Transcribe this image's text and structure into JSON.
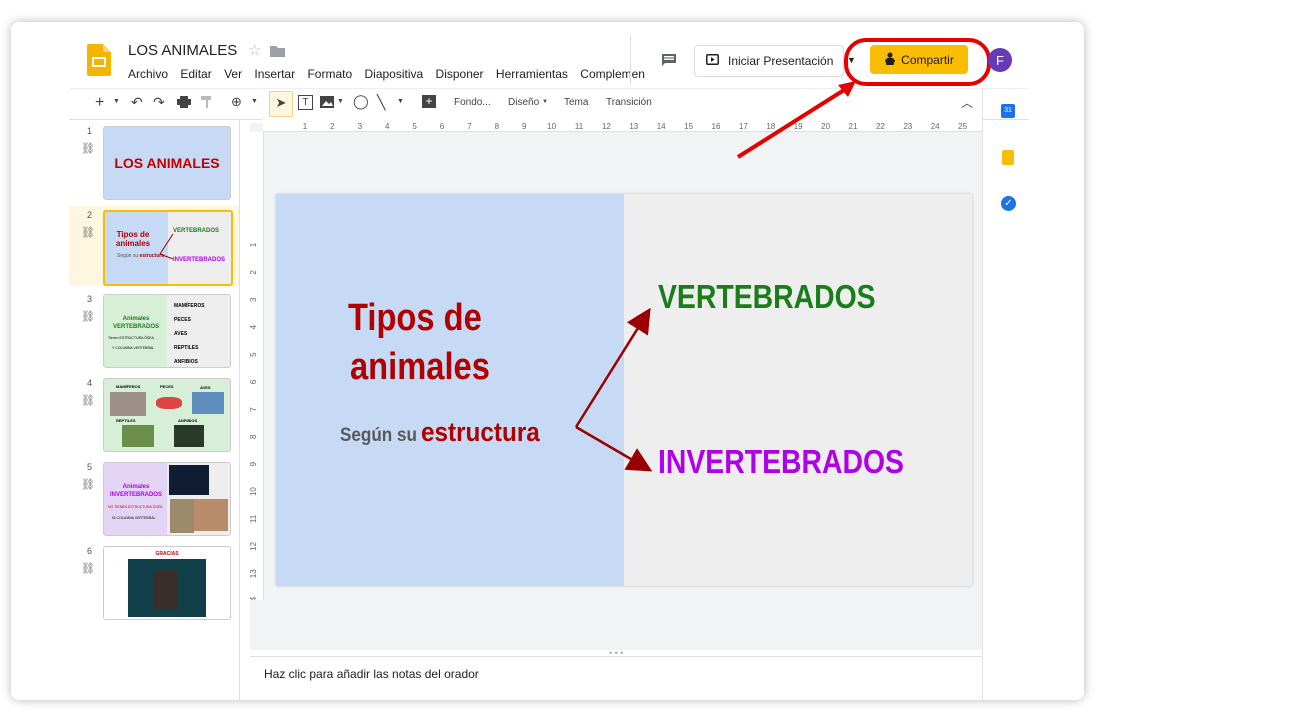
{
  "doc": {
    "title": "LOS ANIMALES"
  },
  "menu": [
    "Archivo",
    "Editar",
    "Ver",
    "Insertar",
    "Formato",
    "Diapositiva",
    "Disponer",
    "Herramientas",
    "Complemen"
  ],
  "header": {
    "present_label": "Iniciar Presentación",
    "share_label": "Compartir",
    "avatar_letter": "F"
  },
  "toolbar": {
    "background": "Fondo...",
    "layout": "Diseño",
    "theme": "Tema",
    "transition": "Transición"
  },
  "ruler": {
    "h_ticks": [
      "1",
      "2",
      "3",
      "4",
      "5",
      "6",
      "7",
      "8",
      "9",
      "10",
      "11",
      "12",
      "13",
      "14",
      "15",
      "16",
      "17",
      "18",
      "19",
      "20",
      "21",
      "22",
      "23",
      "24",
      "25"
    ],
    "v_ticks": [
      "1",
      "2",
      "3",
      "4",
      "5",
      "6",
      "7",
      "8",
      "9",
      "10",
      "11",
      "12",
      "13",
      "14"
    ]
  },
  "thumbnails": [
    {
      "num": "1",
      "text": "LOS ANIMALES"
    },
    {
      "num": "2",
      "title": "Tipos de animales",
      "sub1": "Según su",
      "sub2": "estructura",
      "a": "VERTEBRADOS",
      "b": "INVERTEBRADOS"
    },
    {
      "num": "3",
      "title": "Animales VERTEBRADOS",
      "l1": "Tienen ESTRUCTURA ÓSEA",
      "l2": "Y COLUMNA VERTEBRAL",
      "items": [
        "MAMÍFEROS",
        "PECES",
        "AVES",
        "REPTILES",
        "ANFIBIOS"
      ]
    },
    {
      "num": "4",
      "labels": [
        "MAMÍFEROS",
        "PECES",
        "AVES",
        "REPTILES",
        "ANFIBIOS"
      ]
    },
    {
      "num": "5",
      "title": "Animales INVERTEBRADOS",
      "l1": "NO TIENEN ESTRUCTURA ÓSEA",
      "l2": "NI COLUMNA VERTEBRAL"
    },
    {
      "num": "6",
      "title": "GRACIAS"
    }
  ],
  "slide": {
    "title_line1": "Tipos de",
    "title_line2": "animales",
    "sub_prefix": "Según su",
    "sub_emph": "estructura",
    "right_top": "VERTEBRADOS",
    "right_bottom": "INVERTEBRADOS"
  },
  "notes": {
    "placeholder": "Haz clic para añadir las notas del orador"
  },
  "colors": {
    "accent_yellow": "#fbbc04",
    "highlight_red": "#e60000",
    "vertebrados": "#1a7d1a",
    "invertebrados": "#b000e8",
    "title_red": "#b00000"
  }
}
